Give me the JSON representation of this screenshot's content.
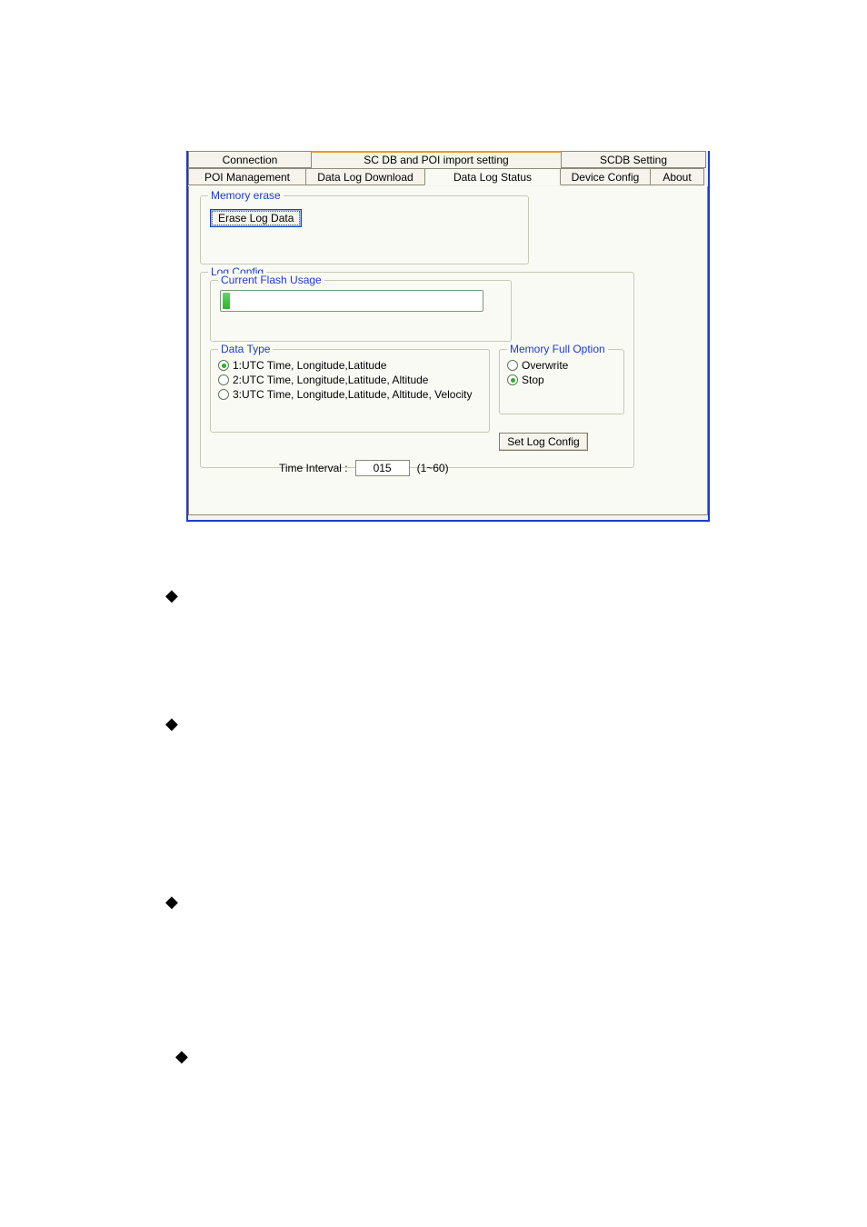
{
  "tabs": {
    "top": {
      "connection": "Connection",
      "sc_poi": "SC DB and POI import setting",
      "scdb_setting": "SCDB  Setting"
    },
    "bottom": {
      "poi_mgmt": "POI Management",
      "data_log_download": "Data Log Download",
      "data_log_status": "Data Log Status",
      "device_config": "Device Config",
      "about": "About"
    }
  },
  "memory_erase": {
    "legend": "Memory erase",
    "erase_btn": "Erase Log Data"
  },
  "log_config": {
    "legend": "Log Config",
    "flash_legend": "Current Flash Usage",
    "data_type": {
      "legend": "Data Type",
      "opt1": "1:UTC Time, Longitude,Latitude",
      "opt2": "2:UTC Time, Longitude,Latitude, Altitude",
      "opt3": "3:UTC Time, Longitude,Latitude, Altitude, Velocity"
    },
    "mem_full": {
      "legend": "Memory Full Option",
      "overwrite": "Overwrite",
      "stop": "Stop"
    },
    "time_interval_label": "Time Interval :",
    "time_interval_value": "015",
    "time_interval_range": "(1~60)",
    "set_btn": "Set Log Config"
  }
}
